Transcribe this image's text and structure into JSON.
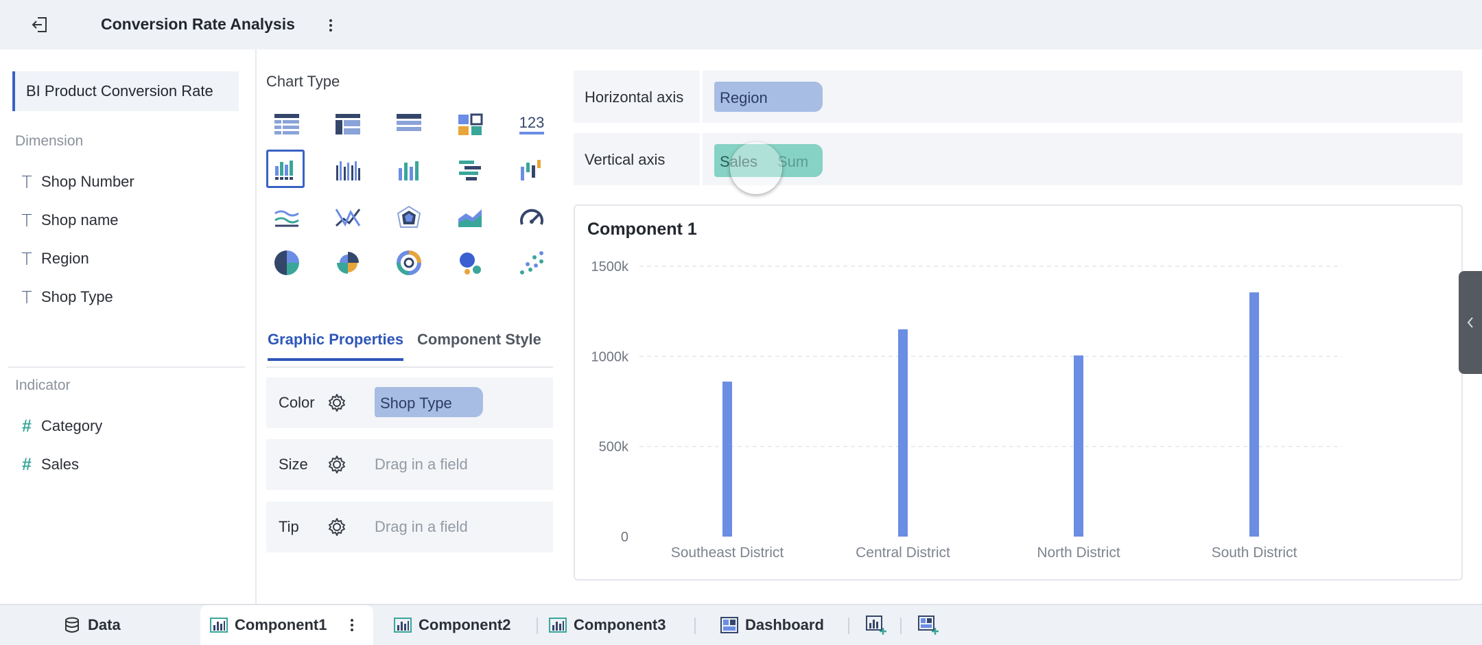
{
  "header": {
    "title": "Conversion Rate Analysis",
    "back_icon": "exit-icon",
    "more_icon": "kebab-menu-icon"
  },
  "left_panel": {
    "dataset": "BI Product Conversion Rate",
    "dimension_label": "Dimension",
    "dimensions": [
      "Shop Number",
      "Shop name",
      "Region",
      "Shop Type"
    ],
    "indicator_label": "Indicator",
    "indicators": [
      "Category",
      "Sales"
    ]
  },
  "middle_panel": {
    "chart_type_label": "Chart Type",
    "chart_types": [
      "table-icon",
      "cross-table-icon",
      "detail-table-icon",
      "card-icon",
      "number-indicator-icon",
      "bar-chart-icon",
      "grouped-bar-icon",
      "stacked-bar-icon",
      "horizontal-bar-icon",
      "waterfall-icon",
      "line-chart-icon",
      "multi-line-icon",
      "radar-chart-icon",
      "area-chart-icon",
      "gauge-icon",
      "pie-chart-icon",
      "rose-chart-icon",
      "ring-chart-icon",
      "bubble-chart-icon",
      "scatter-chart-icon"
    ],
    "selected_chart_type": "bar-chart-icon",
    "tabs": {
      "graphic": "Graphic Properties",
      "style": "Component Style"
    },
    "properties": {
      "color_label": "Color",
      "color_value": "Shop Type",
      "size_label": "Size",
      "size_placeholder": "Drag in a field",
      "tip_label": "Tip",
      "tip_placeholder": "Drag in a field"
    }
  },
  "axes": {
    "horizontal_label": "Horizontal axis",
    "horizontal_field": "Region",
    "vertical_label": "Vertical axis",
    "vertical_field": "Sales",
    "vertical_agg": "Sum"
  },
  "chart_data": {
    "type": "bar",
    "title": "Component 1",
    "categories": [
      "Southeast District",
      "Central District",
      "North District",
      "South District"
    ],
    "values": [
      860000,
      1150000,
      1005000,
      1355000
    ],
    "ylim": [
      0,
      1500000
    ],
    "yticks": [
      {
        "value": 0,
        "label": "0"
      },
      {
        "value": 500000,
        "label": "500k"
      },
      {
        "value": 1000000,
        "label": "1000k"
      },
      {
        "value": 1500000,
        "label": "1500k"
      }
    ],
    "bar_color": "#6b8de3",
    "grid": true
  },
  "bottom_tabs": {
    "data": "Data",
    "component1": "Component1",
    "component2": "Component2",
    "component3": "Component3",
    "dashboard": "Dashboard"
  },
  "colors": {
    "accent": "#2e57b8",
    "dimension_pill": "#a8bde4",
    "indicator_pill": "#86d2c4"
  }
}
